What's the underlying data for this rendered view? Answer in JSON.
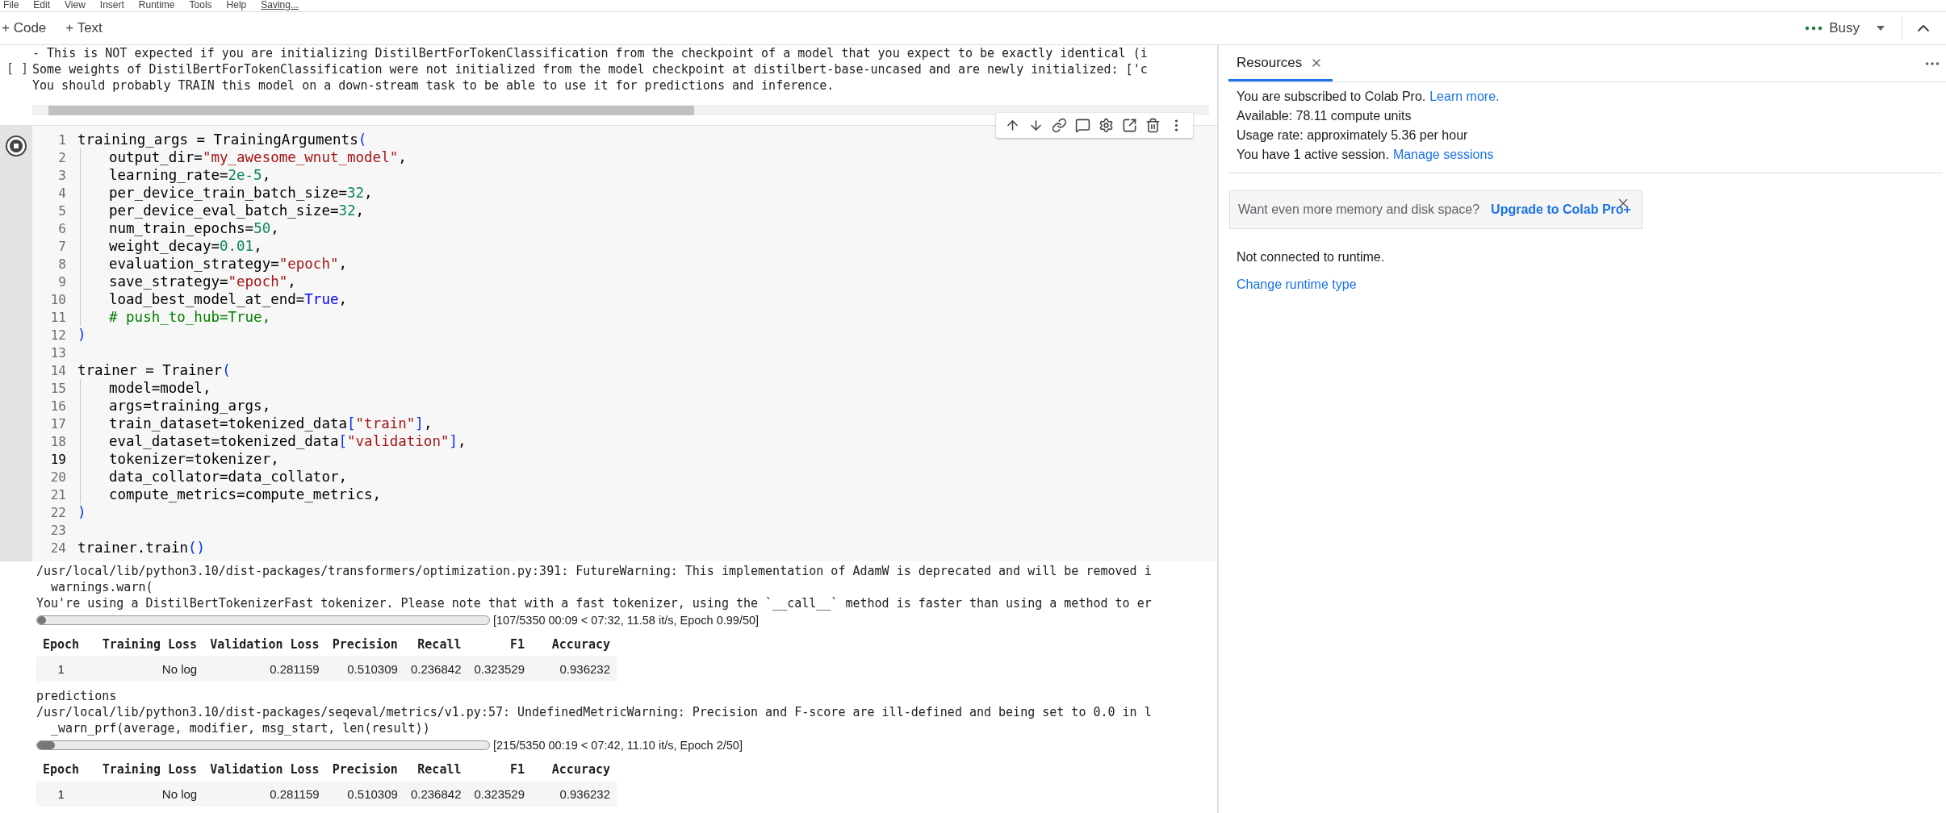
{
  "menu": [
    "File",
    "Edit",
    "View",
    "Insert",
    "Runtime",
    "Tools",
    "Help",
    "Saving..."
  ],
  "toolbar": {
    "add_buttons": [
      "+ Code",
      "+ Text"
    ],
    "status": "Busy"
  },
  "previous_output": {
    "cell_marker": "[ ]",
    "lines": [
      "- This is NOT expected if you are initializing DistilBertForTokenClassification from the checkpoint of a model that you expect to be exactly identical (i",
      "Some weights of DistilBertForTokenClassification were not initialized from the model checkpoint at distilbert-base-uncased and are newly initialized: ['c",
      "You should probably TRAIN this model on a down-stream task to be able to use it for predictions and inference."
    ]
  },
  "code_cell": {
    "running": true,
    "lines": [
      {
        "n": "1",
        "current": false,
        "indented": false,
        "tokens": [
          {
            "kind": "p",
            "text": "training_args = TrainingArguments"
          },
          {
            "kind": "b",
            "text": "("
          }
        ]
      },
      {
        "n": "2",
        "current": false,
        "indented": true,
        "tokens": [
          {
            "kind": "p",
            "text": "output_dir="
          },
          {
            "kind": "s",
            "text": "\"my_awesome_wnut_model\""
          },
          {
            "kind": "p",
            "text": ","
          }
        ]
      },
      {
        "n": "3",
        "current": false,
        "indented": true,
        "tokens": [
          {
            "kind": "p",
            "text": "learning_rate="
          },
          {
            "kind": "n",
            "text": "2e-5"
          },
          {
            "kind": "p",
            "text": ","
          }
        ]
      },
      {
        "n": "4",
        "current": false,
        "indented": true,
        "tokens": [
          {
            "kind": "p",
            "text": "per_device_train_batch_size="
          },
          {
            "kind": "n",
            "text": "32"
          },
          {
            "kind": "p",
            "text": ","
          }
        ]
      },
      {
        "n": "5",
        "current": false,
        "indented": true,
        "tokens": [
          {
            "kind": "p",
            "text": "per_device_eval_batch_size="
          },
          {
            "kind": "n",
            "text": "32"
          },
          {
            "kind": "p",
            "text": ","
          }
        ]
      },
      {
        "n": "6",
        "current": false,
        "indented": true,
        "tokens": [
          {
            "kind": "p",
            "text": "num_train_epochs="
          },
          {
            "kind": "n",
            "text": "50"
          },
          {
            "kind": "p",
            "text": ","
          }
        ]
      },
      {
        "n": "7",
        "current": false,
        "indented": true,
        "tokens": [
          {
            "kind": "p",
            "text": "weight_decay="
          },
          {
            "kind": "n",
            "text": "0.01"
          },
          {
            "kind": "p",
            "text": ","
          }
        ]
      },
      {
        "n": "8",
        "current": false,
        "indented": true,
        "tokens": [
          {
            "kind": "p",
            "text": "evaluation_strategy="
          },
          {
            "kind": "s",
            "text": "\"epoch\""
          },
          {
            "kind": "p",
            "text": ","
          }
        ]
      },
      {
        "n": "9",
        "current": false,
        "indented": true,
        "tokens": [
          {
            "kind": "p",
            "text": "save_strategy="
          },
          {
            "kind": "s",
            "text": "\"epoch\""
          },
          {
            "kind": "p",
            "text": ","
          }
        ]
      },
      {
        "n": "10",
        "current": false,
        "indented": true,
        "tokens": [
          {
            "kind": "p",
            "text": "load_best_model_at_end="
          },
          {
            "kind": "k",
            "text": "True"
          },
          {
            "kind": "p",
            "text": ","
          }
        ]
      },
      {
        "n": "11",
        "current": false,
        "indented": true,
        "tokens": [
          {
            "kind": "c",
            "text": "# push_to_hub=True,"
          }
        ]
      },
      {
        "n": "12",
        "current": false,
        "indented": false,
        "tokens": [
          {
            "kind": "b",
            "text": ")"
          }
        ]
      },
      {
        "n": "13",
        "current": false,
        "indented": false
      },
      {
        "n": "14",
        "current": false,
        "indented": false,
        "tokens": [
          {
            "kind": "p",
            "text": "trainer = Trainer"
          },
          {
            "kind": "b",
            "text": "("
          }
        ]
      },
      {
        "n": "15",
        "current": false,
        "indented": true,
        "tokens": [
          {
            "kind": "p",
            "text": "model=model,"
          }
        ]
      },
      {
        "n": "16",
        "current": false,
        "indented": true,
        "tokens": [
          {
            "kind": "p",
            "text": "args=training_args,"
          }
        ]
      },
      {
        "n": "17",
        "current": false,
        "indented": true,
        "tokens": [
          {
            "kind": "p",
            "text": "train_dataset=tokenized_data"
          },
          {
            "kind": "b",
            "text": "["
          },
          {
            "kind": "s",
            "text": "\"train\""
          },
          {
            "kind": "b",
            "text": "]"
          },
          {
            "kind": "p",
            "text": ","
          }
        ]
      },
      {
        "n": "18",
        "current": false,
        "indented": true,
        "tokens": [
          {
            "kind": "p",
            "text": "eval_dataset=tokenized_data"
          },
          {
            "kind": "b",
            "text": "["
          },
          {
            "kind": "s",
            "text": "\"validation\""
          },
          {
            "kind": "b",
            "text": "]"
          },
          {
            "kind": "p",
            "text": ","
          }
        ]
      },
      {
        "n": "19",
        "current": true,
        "indented": true,
        "tokens": [
          {
            "kind": "p",
            "text": "tokenizer=tokenizer,"
          }
        ]
      },
      {
        "n": "20",
        "current": false,
        "indented": true,
        "tokens": [
          {
            "kind": "p",
            "text": "data_collator=data_collator,"
          }
        ]
      },
      {
        "n": "21",
        "current": false,
        "indented": true,
        "tokens": [
          {
            "kind": "p",
            "text": "compute_metrics=compute_metrics,"
          }
        ]
      },
      {
        "n": "22",
        "current": false,
        "indented": false,
        "tokens": [
          {
            "kind": "b",
            "text": ")"
          }
        ]
      },
      {
        "n": "23",
        "current": false,
        "indented": false
      },
      {
        "n": "24",
        "current": false,
        "indented": false,
        "tokens": [
          {
            "kind": "p",
            "text": "trainer.train"
          },
          {
            "kind": "b",
            "text": "()"
          }
        ]
      }
    ]
  },
  "output": [
    {
      "kind": "text",
      "text": "/usr/local/lib/python3.10/dist-packages/transformers/optimization.py:391: FutureWarning: This implementation of AdamW is deprecated and will be removed i"
    },
    {
      "kind": "text",
      "text": "  warnings.warn("
    },
    {
      "kind": "text",
      "text": "You're using a DistilBertTokenizerFast tokenizer. Please note that with a fast tokenizer, using the `__call__` method is faster than using a method to er"
    },
    {
      "kind": "progress",
      "level": 0.02,
      "label": "[107/5350 00:09 < 07:32, 11.58 it/s, Epoch 0.99/50]"
    },
    {
      "kind": "table",
      "columns": [
        "Epoch",
        "Training Loss",
        "Validation Loss",
        "Precision",
        "Recall",
        "F1",
        "Accuracy"
      ],
      "rows": [
        [
          "1",
          "No log",
          "0.281159",
          "0.510309",
          "0.236842",
          "0.323529",
          "0.936232"
        ]
      ]
    },
    {
      "kind": "text",
      "text": "predictions"
    },
    {
      "kind": "text",
      "text": "/usr/local/lib/python3.10/dist-packages/seqeval/metrics/v1.py:57: UndefinedMetricWarning: Precision and F-score are ill-defined and being set to 0.0 in l"
    },
    {
      "kind": "text",
      "text": "  _warn_prf(average, modifier, msg_start, len(result))"
    },
    {
      "kind": "progress",
      "level": 0.04,
      "label": "[215/5350 00:19 < 07:42, 11.10 it/s, Epoch 2/50]"
    },
    {
      "kind": "table",
      "columns": [
        "Epoch",
        "Training Loss",
        "Validation Loss",
        "Precision",
        "Recall",
        "F1",
        "Accuracy"
      ],
      "rows": [
        [
          "1",
          "No log",
          "0.281159",
          "0.510309",
          "0.236842",
          "0.323529",
          "0.936232"
        ]
      ]
    }
  ],
  "side_panel": {
    "tab": {
      "label": "Resources",
      "selected": true
    },
    "info": [
      {
        "text": "You are subscribed to Colab Pro.",
        "link": "Learn more."
      },
      {
        "text": "Available: 78.11 compute units"
      },
      {
        "text": "Usage rate: approximately 5.36 per hour"
      },
      {
        "text": "You have 1 active session.",
        "link": "Manage sessions"
      }
    ],
    "promo": {
      "text": "Want even more memory and disk space?",
      "link": "Upgrade to Colab Pro+"
    },
    "status": "Not connected to runtime.",
    "action": "Change runtime type"
  }
}
